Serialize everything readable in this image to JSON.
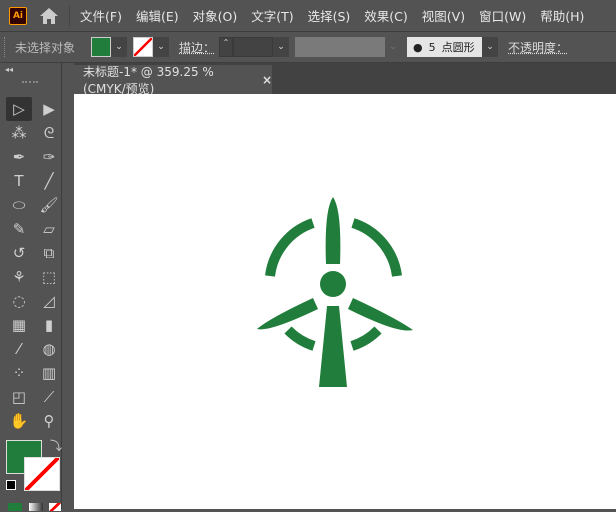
{
  "app": {
    "logo": "Ai"
  },
  "menu": [
    "文件(F)",
    "编辑(E)",
    "对象(O)",
    "文字(T)",
    "选择(S)",
    "效果(C)",
    "视图(V)",
    "窗口(W)",
    "帮助(H)"
  ],
  "control": {
    "selection": "未选择对象",
    "stroke_label": "描边：",
    "brush_value": "5",
    "brush_name": "点圆形",
    "opacity_label": "不透明度："
  },
  "document": {
    "tab_title": "未标题-1* @ 359.25 % (CMYK/预览)",
    "close": "×"
  },
  "colors": {
    "fill": "#217d3b",
    "ui": "#535353"
  },
  "tools": [
    "selection",
    "direct-selection",
    "magic-wand",
    "lasso",
    "pen",
    "curvature",
    "type",
    "line-segment",
    "ellipse",
    "paintbrush",
    "shaper",
    "eraser",
    "rotate",
    "scale",
    "puppet-warp",
    "free-transform",
    "shape-builder",
    "perspective-grid",
    "mesh",
    "gradient",
    "eyedropper",
    "blend",
    "symbol-sprayer",
    "column-graph",
    "artboard",
    "slice",
    "hand",
    "zoom"
  ]
}
